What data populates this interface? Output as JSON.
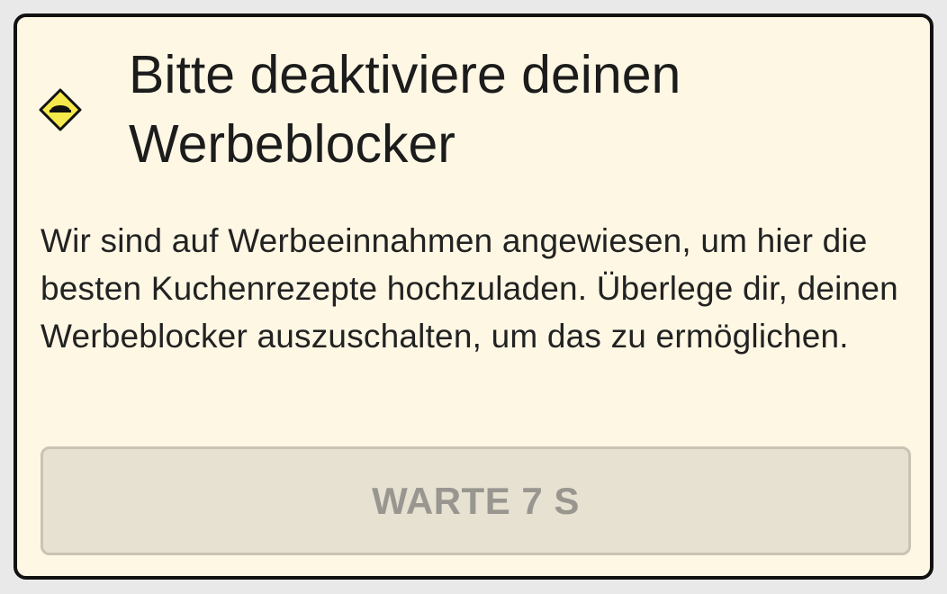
{
  "dialog": {
    "icon": "warning-diamond-icon",
    "title": "Bitte deaktiviere deinen Werbeblocker",
    "message": "Wir sind auf Werbeeinnahmen angewiesen, um hier die besten Kuchenrezepte hochzuladen. Überlege dir, deinen Werbeblocker auszuschalten, um das zu ermöglichen.",
    "button_label": "WARTE 7 S"
  },
  "colors": {
    "background": "#fdf7e4",
    "border": "#111111",
    "icon_fill": "#f5e94b",
    "button_background": "#e6e1d0",
    "button_text": "#999690"
  }
}
